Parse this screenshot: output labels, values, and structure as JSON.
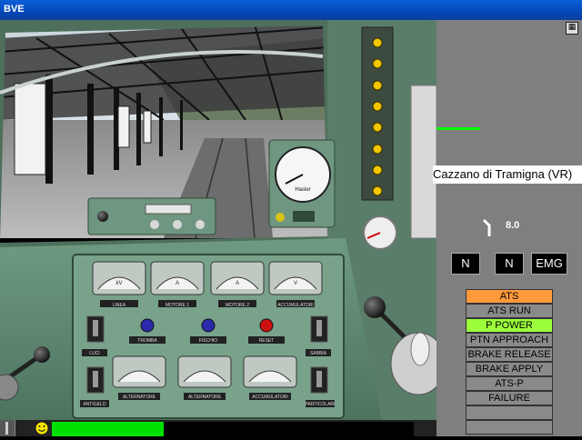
{
  "window": {
    "title": "BVE"
  },
  "panel": {
    "station": "Cazzano di Tramigna (VR)",
    "speed_limit": "8.0",
    "reverser": "N",
    "power_notch": "N",
    "brake_notch": "EMG",
    "indicators": [
      {
        "label": "ATS",
        "state": "active",
        "color": "#ff9a3c"
      },
      {
        "label": "ATS RUN",
        "state": "off"
      },
      {
        "label": "P POWER",
        "state": "active",
        "color": "#9cff3c"
      },
      {
        "label": "PTN APPROACH",
        "state": "off"
      },
      {
        "label": "BRAKE RELEASE",
        "state": "off"
      },
      {
        "label": "BRAKE APPLY",
        "state": "off"
      },
      {
        "label": "ATS-P",
        "state": "off"
      },
      {
        "label": "FAILURE",
        "state": "off"
      },
      {
        "label": "",
        "state": "off"
      },
      {
        "label": "",
        "state": "off"
      }
    ]
  },
  "cab": {
    "gauges_top": [
      "LINEA",
      "MOTORE 1",
      "MOTORE 2",
      "ACCUMULATORI"
    ],
    "gauge_top_units": [
      "kV",
      "A",
      "A",
      "V"
    ],
    "buttons": [
      "TROMBA",
      "FISCHIO",
      "RESET"
    ],
    "gauges_bottom": [
      "ALTERNATORE",
      "ALTERNATORE",
      "ACCUMULATORI"
    ],
    "switch_labels": [
      "LUCI",
      "SABBIA",
      "ANTIGELO",
      "PARTICOLARI"
    ],
    "speedometer_brand": "Hasler"
  },
  "status": {
    "progress": 0.31,
    "progress_color": "#00e000"
  },
  "colors": {
    "panel_bg": "#7f7f7f",
    "cab_green": "#5f8a72",
    "indicator_off": "#8a8a8a"
  }
}
